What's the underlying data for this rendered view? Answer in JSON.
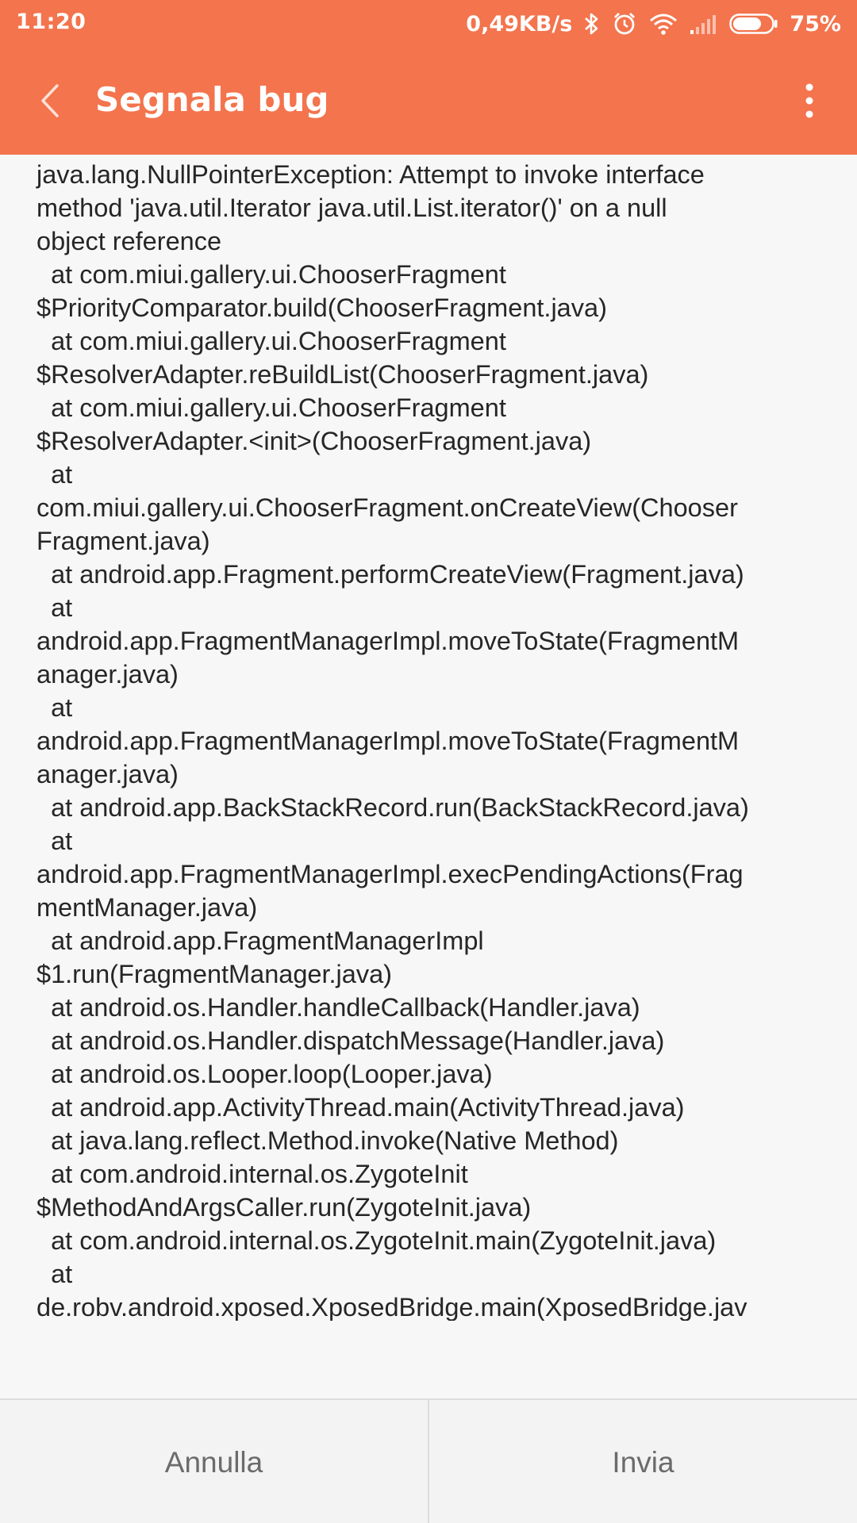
{
  "status_bar": {
    "time": "11:20",
    "network_speed": "0,49KB/s",
    "battery_percent": "75%",
    "battery_level": 0.75,
    "icons": [
      "bluetooth-icon",
      "alarm-icon",
      "wifi-icon",
      "signal-icon",
      "battery-icon"
    ]
  },
  "toolbar": {
    "title": "Segnala bug",
    "back_icon": "chevron-left-icon",
    "more_icon": "more-vertical-icon"
  },
  "log": {
    "lines": [
      "java.lang.NullPointerException: Attempt to invoke interface",
      "method 'java.util.Iterator java.util.List.iterator()' on a null",
      "object reference",
      "  at com.miui.gallery.ui.ChooserFragment",
      "$PriorityComparator.build(ChooserFragment.java)",
      "  at com.miui.gallery.ui.ChooserFragment",
      "$ResolverAdapter.reBuildList(ChooserFragment.java)",
      "  at com.miui.gallery.ui.ChooserFragment",
      "$ResolverAdapter.<init>(ChooserFragment.java)",
      "  at",
      "com.miui.gallery.ui.ChooserFragment.onCreateView(Chooser",
      "Fragment.java)",
      "  at android.app.Fragment.performCreateView(Fragment.java)",
      "  at",
      "android.app.FragmentManagerImpl.moveToState(FragmentM",
      "anager.java)",
      "  at",
      "android.app.FragmentManagerImpl.moveToState(FragmentM",
      "anager.java)",
      "  at android.app.BackStackRecord.run(BackStackRecord.java)",
      "  at",
      "android.app.FragmentManagerImpl.execPendingActions(Frag",
      "mentManager.java)",
      "  at android.app.FragmentManagerImpl",
      "$1.run(FragmentManager.java)",
      "  at android.os.Handler.handleCallback(Handler.java)",
      "  at android.os.Handler.dispatchMessage(Handler.java)",
      "  at android.os.Looper.loop(Looper.java)",
      "  at android.app.ActivityThread.main(ActivityThread.java)",
      "  at java.lang.reflect.Method.invoke(Native Method)",
      "  at com.android.internal.os.ZygoteInit",
      "$MethodAndArgsCaller.run(ZygoteInit.java)",
      "  at com.android.internal.os.ZygoteInit.main(ZygoteInit.java)",
      "  at",
      "de.robv.android.xposed.XposedBridge.main(XposedBridge.jav"
    ]
  },
  "buttons": {
    "cancel_label": "Annulla",
    "send_label": "Invia"
  },
  "colors": {
    "accent": "#f3744d",
    "text": "#262626",
    "button_text": "#6b6b6b",
    "background": "#f7f7f7"
  }
}
